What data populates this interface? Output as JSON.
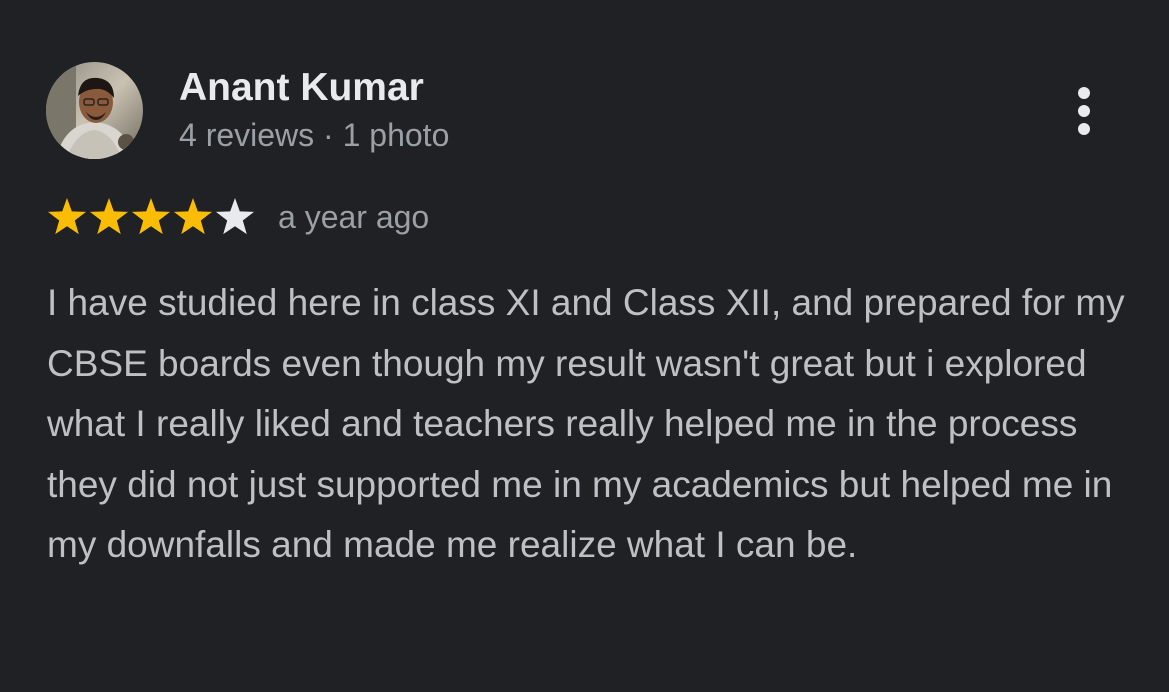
{
  "review": {
    "author": {
      "name": "Anant Kumar",
      "meta": "4 reviews · 1 photo",
      "avatar": "profile-photo"
    },
    "rating": {
      "value": 4,
      "max": 5,
      "filled_color": "#fbbc04",
      "empty_color": "#e8eaed"
    },
    "date": "a year ago",
    "text": "I have studied here in class XI and Class XII, and prepared for my CBSE boards even though my result wasn't great but i explored what I really liked and teachers really helped me in the process they did not just supported me in my academics but helped me in my downfalls and made me realize what I can be."
  },
  "menu": {
    "icon": "more-vertical-icon"
  },
  "colors": {
    "background": "#202124",
    "name_text": "#e8eaed",
    "secondary_text": "#9aa0a6",
    "body_text": "#bdc1c6"
  }
}
